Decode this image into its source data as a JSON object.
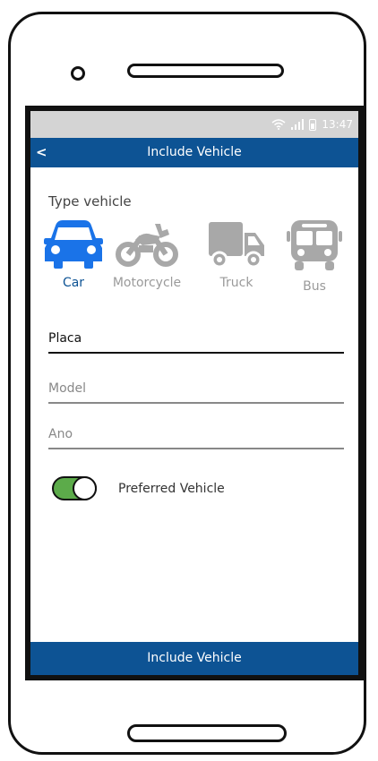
{
  "status_bar": {
    "time": "13:47"
  },
  "app_bar": {
    "back_label": "<",
    "title": "Include Vehicle"
  },
  "type_section": {
    "label": "Type vehicle"
  },
  "vehicles": [
    {
      "label": "Car",
      "icon": "car-icon",
      "selected": true
    },
    {
      "label": "Motorcycle",
      "icon": "motorcycle-icon",
      "selected": false
    },
    {
      "label": "Truck",
      "icon": "truck-icon",
      "selected": false
    },
    {
      "label": "Bus",
      "icon": "bus-icon",
      "selected": false
    }
  ],
  "fields": {
    "placa": "Placa",
    "model": "Model",
    "ano": "Ano"
  },
  "preferred": {
    "label": "Preferred Vehicle",
    "on": true
  },
  "submit": {
    "label": "Include Vehicle"
  },
  "colors": {
    "primary": "#0d5394",
    "selected_icon": "#1a73e8",
    "inactive_icon": "#a8a8a8",
    "toggle_on": "#5cab4a",
    "status_bar": "#d4d4d4"
  }
}
